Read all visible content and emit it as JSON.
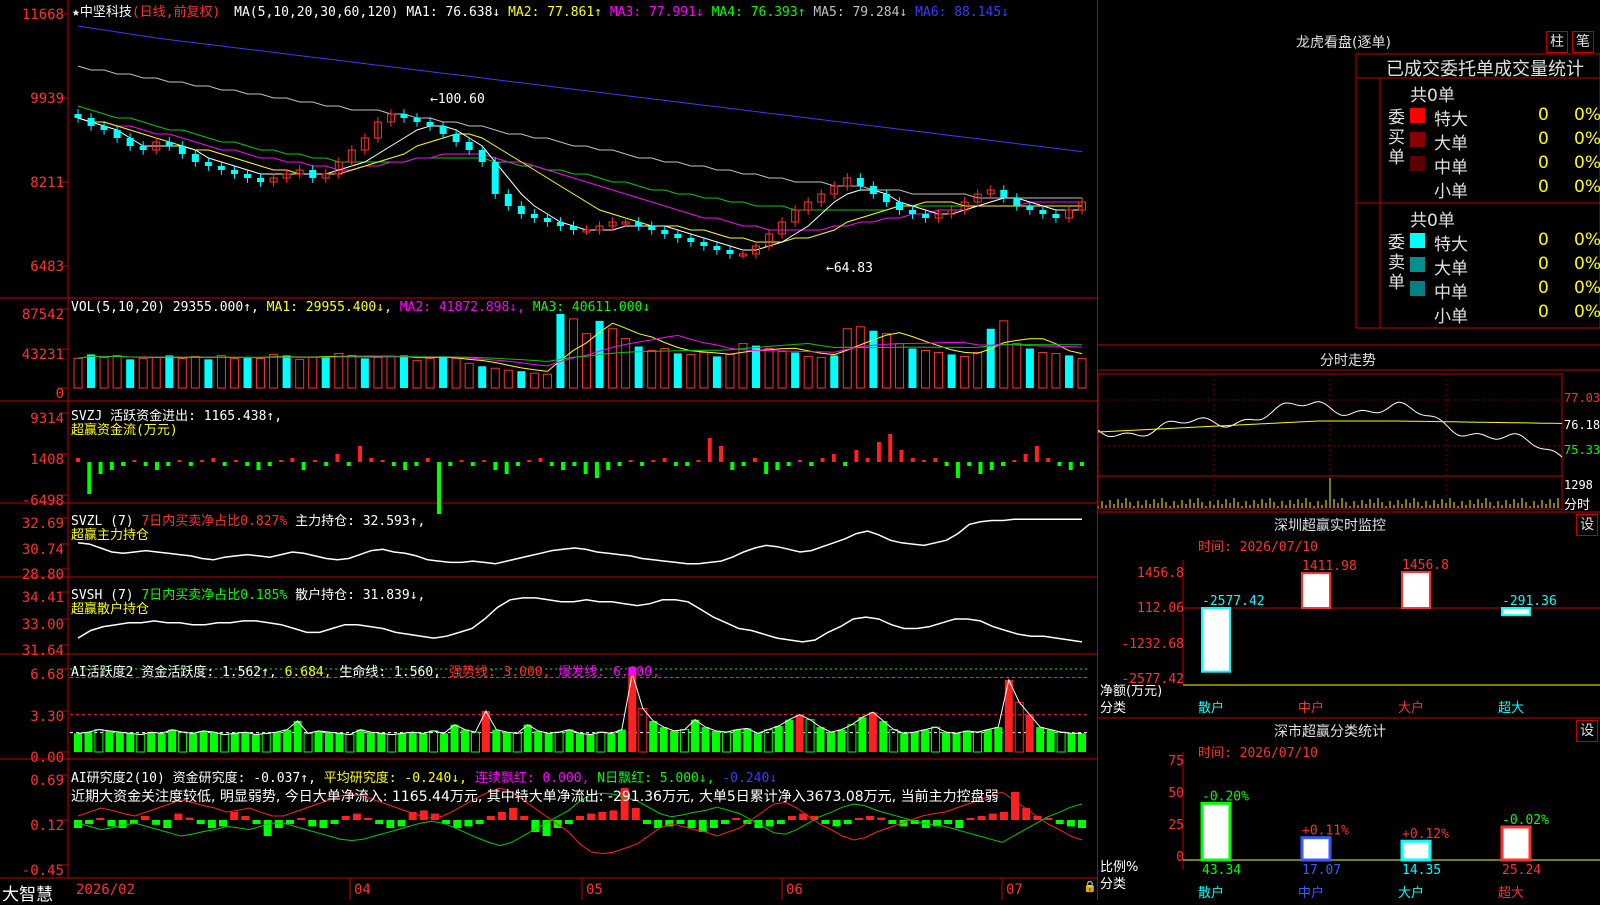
{
  "main": {
    "title": "★中坚科技",
    "period": "(日线,前复权)",
    "ma_prefix": "MA(5,10,20,30,60,120)",
    "ma_items": [
      {
        "label": "MA1: 76.638↓",
        "color": "#ffffff"
      },
      {
        "label": "MA2: 77.861↑",
        "color": "#ffff00"
      },
      {
        "label": "MA3: 77.991↓",
        "color": "#ff00ff"
      },
      {
        "label": "MA4: 76.393↑",
        "color": "#00ff00"
      },
      {
        "label": "MA5: 79.284↓",
        "color": "#c0c0c0"
      },
      {
        "label": "MA6: 88.145↓",
        "color": "#3a3aff"
      }
    ],
    "y_ticks": [
      "11668",
      "9939",
      "8211",
      "6483"
    ],
    "high_label": "100.60",
    "low_label": "64.83",
    "price_series": {
      "closes": [
        99,
        97,
        96,
        94,
        92,
        91,
        93,
        92,
        90,
        88,
        87,
        86,
        85,
        84,
        83,
        84,
        85,
        86,
        84,
        85,
        88,
        91,
        94,
        98,
        100,
        99,
        98,
        97,
        95,
        93,
        91,
        88,
        80,
        77,
        75,
        74,
        73,
        72,
        71,
        71,
        72,
        73,
        73,
        72,
        71,
        70,
        69,
        68,
        67,
        66,
        65,
        65,
        67,
        70,
        73,
        76,
        78,
        80,
        82,
        84,
        82,
        80,
        78,
        76,
        75,
        74,
        75,
        76,
        78,
        80,
        81,
        79,
        77,
        76,
        75,
        74,
        76,
        78
      ],
      "ma5": [
        99,
        98,
        97,
        96,
        94,
        92,
        92,
        92,
        92,
        91,
        89,
        88,
        87,
        86,
        85,
        85,
        85,
        85,
        85,
        85,
        86,
        87,
        88,
        90,
        92,
        94,
        96,
        97,
        97,
        96,
        94,
        92,
        88,
        84,
        80,
        77,
        75,
        73,
        72,
        71,
        71,
        71,
        72,
        72,
        72,
        72,
        71,
        70,
        69,
        68,
        67,
        66,
        66,
        67,
        68,
        70,
        72,
        75,
        78,
        80,
        81,
        81,
        80,
        78,
        77,
        76,
        75,
        75,
        76,
        77,
        78,
        79,
        79,
        78,
        77,
        76,
        76,
        76
      ],
      "ma10": [
        99,
        98,
        98,
        97,
        96,
        95,
        94,
        93,
        92,
        91,
        91,
        90,
        89,
        88,
        87,
        86,
        86,
        85,
        85,
        85,
        85,
        86,
        87,
        88,
        89,
        90,
        92,
        93,
        94,
        95,
        95,
        94,
        92,
        90,
        88,
        86,
        84,
        82,
        80,
        78,
        76,
        75,
        74,
        73,
        72,
        72,
        72,
        71,
        71,
        70,
        69,
        69,
        68,
        68,
        68,
        69,
        69,
        70,
        71,
        73,
        74,
        75,
        76,
        77,
        77,
        78,
        78,
        78,
        77,
        77,
        77,
        77,
        77,
        77,
        77,
        77,
        77,
        77
      ],
      "ma20": [
        99,
        98,
        98,
        97,
        97,
        96,
        95,
        95,
        94,
        93,
        92,
        91,
        91,
        90,
        89,
        89,
        88,
        88,
        87,
        87,
        86,
        86,
        87,
        87,
        88,
        88,
        89,
        89,
        90,
        90,
        90,
        90,
        89,
        88,
        88,
        87,
        86,
        85,
        84,
        83,
        82,
        81,
        80,
        79,
        78,
        77,
        76,
        75,
        74,
        74,
        73,
        72,
        72,
        71,
        71,
        71,
        71,
        71,
        72,
        72,
        73,
        73,
        74,
        74,
        75,
        75,
        76,
        76,
        76,
        77,
        77,
        77,
        77,
        78,
        78,
        78,
        78,
        78
      ],
      "ma30": [
        102,
        101,
        100,
        99,
        99,
        98,
        97,
        96,
        96,
        95,
        94,
        93,
        93,
        92,
        91,
        91,
        90,
        90,
        89,
        89,
        88,
        88,
        88,
        88,
        88,
        88,
        89,
        89,
        89,
        89,
        89,
        89,
        88,
        88,
        87,
        87,
        86,
        86,
        85,
        85,
        84,
        83,
        83,
        82,
        81,
        81,
        80,
        80,
        79,
        79,
        78,
        78,
        77,
        77,
        77,
        76,
        76,
        76,
        76,
        76,
        76,
        76,
        76,
        77,
        77,
        77,
        77,
        77,
        77,
        77,
        77,
        77,
        77,
        77,
        77,
        77,
        77,
        77
      ],
      "ma60": [
        112,
        111,
        111,
        110,
        110,
        109,
        109,
        108,
        108,
        107,
        107,
        106,
        106,
        105,
        105,
        104,
        104,
        103,
        103,
        102,
        102,
        101,
        101,
        101,
        100,
        100,
        99,
        99,
        98,
        98,
        97,
        97,
        96,
        95,
        95,
        94,
        94,
        93,
        92,
        92,
        91,
        91,
        90,
        89,
        89,
        88,
        88,
        87,
        87,
        86,
        86,
        85,
        85,
        84,
        84,
        83,
        83,
        83,
        82,
        82,
        82,
        81,
        81,
        81,
        80,
        80,
        80,
        80,
        80,
        79,
        79,
        79,
        79,
        79,
        79,
        79,
        79,
        79
      ],
      "ma120": [
        122,
        121.5,
        121,
        120.5,
        120,
        119.5,
        119,
        118.6,
        118.2,
        117.8,
        117.4,
        117,
        116.6,
        116.2,
        115.8,
        115.4,
        115,
        114.6,
        114.2,
        113.8,
        113.4,
        113,
        112.6,
        112.2,
        111.8,
        111.4,
        111,
        110.6,
        110.2,
        109.8,
        109.4,
        109,
        108.6,
        108.2,
        107.8,
        107.4,
        107,
        106.6,
        106.2,
        105.8,
        105.4,
        105,
        104.6,
        104.2,
        103.8,
        103.4,
        103,
        102.6,
        102.2,
        101.8,
        101.4,
        101,
        100.6,
        100.2,
        99.8,
        99.4,
        99,
        98.6,
        98.2,
        97.8,
        97.4,
        97,
        96.6,
        96.2,
        95.8,
        95.4,
        95,
        94.6,
        94.2,
        93.8,
        93.4,
        93,
        92.6,
        92.2,
        91.8,
        91.4,
        91,
        90.6
      ]
    }
  },
  "vol": {
    "header": "VOL(5,10,20)",
    "value": "29355.000↑,",
    "ma_items": [
      {
        "label": "MA1: 29955.400↓,",
        "color": "#ffff00"
      },
      {
        "label": "MA2: 41872.898↓,",
        "color": "#ff00ff"
      },
      {
        "label": "MA3: 40611.000↓",
        "color": "#00ff00"
      }
    ],
    "y_ticks": [
      "87542",
      "43231",
      "0"
    ],
    "values": [
      30,
      34,
      31,
      33,
      29,
      30,
      31,
      33,
      30,
      32,
      29,
      33,
      30,
      31,
      30,
      34,
      33,
      29,
      31,
      32,
      35,
      33,
      30,
      31,
      32,
      33,
      28,
      30,
      32,
      30,
      25,
      22,
      20,
      18,
      17,
      15,
      14,
      75,
      70,
      55,
      68,
      60,
      50,
      42,
      38,
      40,
      35,
      34,
      36,
      32,
      34,
      45,
      43,
      40,
      37,
      36,
      32,
      31,
      33,
      60,
      62,
      58,
      55,
      45,
      40,
      38,
      36,
      34,
      32,
      36,
      60,
      68,
      45,
      40,
      36,
      35,
      33,
      30
    ]
  },
  "svzj": {
    "header": "SVZJ  活跃资金进出: 1165.438↑,",
    "sub": "超赢资金流(万元)",
    "y_ticks": [
      "9314",
      "1408",
      "-6498"
    ],
    "values": [
      1,
      -8,
      -3,
      -2,
      -1,
      0,
      -1,
      -2,
      -1,
      0,
      -1,
      0,
      1,
      -1,
      0,
      -1,
      -2,
      -1,
      0,
      1,
      -2,
      0,
      -1,
      2,
      -1,
      4,
      1,
      0,
      -1,
      -2,
      -1,
      1,
      -13,
      -1,
      0,
      -1,
      0,
      -2,
      -3,
      -1,
      0,
      1,
      -1,
      -2,
      -1,
      -3,
      -4,
      -2,
      -1,
      0,
      -1,
      0,
      1,
      -1,
      -1,
      0,
      6,
      4,
      -2,
      -1,
      1,
      -3,
      -2,
      -1,
      0,
      -1,
      1,
      2,
      -1,
      3,
      1,
      5,
      7,
      3,
      1,
      0,
      1,
      -1,
      -4,
      -1,
      -3,
      -2,
      -1,
      0,
      2,
      4,
      1,
      -1,
      -2,
      -1
    ]
  },
  "svzl": {
    "header_a": "SVZL (7)",
    "header_b": "7日内买卖净占比0.827%",
    "header_c": "主力持仓: 32.593↑,",
    "sub": "超赢主力持仓",
    "y_ticks": [
      "32.69",
      "30.74",
      "28.80"
    ],
    "values": [
      30.8,
      30.7,
      30.4,
      30.1,
      30.0,
      30.1,
      30.2,
      30.1,
      30.0,
      29.9,
      29.8,
      29.6,
      29.5,
      29.7,
      29.8,
      29.9,
      29.8,
      29.7,
      29.9,
      30.1,
      30.0,
      29.8,
      29.6,
      29.5,
      29.6,
      29.9,
      30.2,
      30.3,
      30.1,
      30.0,
      29.8,
      29.5,
      29.4,
      29.3,
      29.3,
      29.4,
      29.3,
      29.2,
      29.4,
      29.6,
      29.8,
      30.0,
      30.2,
      30.3,
      30.4,
      30.3,
      30.1,
      30.0,
      29.9,
      29.8,
      29.6,
      29.5,
      29.4,
      29.3,
      29.2,
      29.2,
      29.3,
      29.4,
      29.7,
      30.1,
      30.4,
      30.6,
      30.5,
      30.3,
      30.1,
      30.2,
      30.5,
      30.8,
      31.1,
      31.5,
      31.7,
      31.4,
      31.0,
      30.8,
      30.7,
      30.6,
      30.8,
      31.0,
      31.5,
      32.2,
      32.4,
      32.5,
      32.5,
      32.6,
      32.6,
      32.6,
      32.6,
      32.6,
      32.6,
      32.6
    ]
  },
  "svsh": {
    "header_a": "SVSH (7)",
    "header_b": "7日内买卖净占比0.185%",
    "header_c": "散户持仓: 31.839↓,",
    "sub": "超赢散户持仓",
    "y_ticks": [
      "34.41",
      "33.00",
      "31.64"
    ],
    "values": [
      32.0,
      32.4,
      32.6,
      32.7,
      32.8,
      32.8,
      32.9,
      32.8,
      32.8,
      32.7,
      32.7,
      32.8,
      32.8,
      32.9,
      32.9,
      32.8,
      32.7,
      32.5,
      32.3,
      32.3,
      32.5,
      32.7,
      32.7,
      32.6,
      32.5,
      32.3,
      32.2,
      32.1,
      32.0,
      32.1,
      32.3,
      32.5,
      33.0,
      33.6,
      34.0,
      34.1,
      34.1,
      34.0,
      33.9,
      33.9,
      34.0,
      33.9,
      33.9,
      33.8,
      33.7,
      33.8,
      34.0,
      34.0,
      33.9,
      33.5,
      33.1,
      32.8,
      32.5,
      32.4,
      32.2,
      32.0,
      31.9,
      31.8,
      31.9,
      32.3,
      32.6,
      33.0,
      33.1,
      33.0,
      32.7,
      32.5,
      32.5,
      32.6,
      32.8,
      33.0,
      33.0,
      32.9,
      32.6,
      32.4,
      32.2,
      32.1,
      32.1,
      32.0,
      31.9,
      31.8
    ]
  },
  "ai1": {
    "header": "AI活跃度2",
    "items": [
      {
        "label": "资金活跃度: 1.562↑,",
        "color": "#ffffff"
      },
      {
        "label": "6.684,",
        "color": "#ffff00"
      },
      {
        "label": "生命线: 1.560,",
        "color": "#ffffff"
      },
      {
        "label": "强势线: 3.000,",
        "color": "#ff3030"
      },
      {
        "label": "爆发线: 6.000,",
        "color": "#ff00ff"
      }
    ],
    "y_ticks": [
      "6.68",
      "3.30",
      "0.00"
    ],
    "values": [
      1.5,
      1.6,
      1.8,
      1.7,
      1.6,
      1.5,
      1.4,
      1.6,
      1.5,
      1.8,
      1.6,
      1.5,
      1.7,
      1.6,
      1.4,
      1.5,
      1.6,
      1.4,
      1.5,
      1.6,
      1.8,
      2.5,
      1.5,
      1.7,
      1.6,
      1.5,
      1.4,
      1.8,
      1.6,
      1.5,
      1.4,
      1.5,
      1.6,
      1.5,
      1.7,
      1.5,
      2.2,
      1.8,
      1.6,
      3.3,
      1.8,
      1.6,
      1.5,
      2.2,
      1.7,
      1.5,
      1.6,
      1.8,
      1.5,
      1.4,
      1.6,
      1.5,
      1.8,
      6.3,
      3.5,
      2.5,
      2.0,
      1.7,
      1.8,
      2.6,
      2.0,
      1.7,
      1.6,
      1.8,
      1.9,
      1.5,
      1.8,
      2.1,
      2.6,
      3.0,
      2.6,
      2.0,
      1.6,
      1.8,
      2.2,
      2.8,
      3.2,
      2.5,
      1.8,
      1.5,
      1.6,
      1.8,
      2.0,
      1.6,
      1.5,
      1.7,
      1.6,
      1.8,
      2.0,
      5.8,
      4.0,
      3.0,
      2.0,
      1.8,
      1.6,
      1.5,
      1.5
    ]
  },
  "ai2": {
    "header": "AI研究度2(10)",
    "items": [
      {
        "label": "资金研究度: -0.037↑,",
        "color": "#ffffff"
      },
      {
        "label": "平均研究度: -0.240↓,",
        "color": "#ffff00"
      },
      {
        "label": "连续飘红: 0.000,",
        "color": "#ff00ff"
      },
      {
        "label": "N日飘红: 5.000↓,",
        "color": "#00ff00"
      },
      {
        "label": "-0.240↓",
        "color": "#3a3aff"
      }
    ],
    "note": "近期大资金关注度较低, 明显弱势, 今日大单净流入: 1165.44万元, 其中特大单净流出: -291.36万元, 大单5日累计净入3673.08万元, 当前主力控盘弱",
    "y_ticks": [
      "0.69",
      "0.12",
      "-0.45"
    ],
    "values": [
      -0.1,
      -0.05,
      0.02,
      -0.08,
      -0.1,
      -0.05,
      0.05,
      -0.06,
      -0.1,
      0.08,
      0.03,
      -0.05,
      -0.1,
      -0.08,
      0.1,
      0.05,
      -0.05,
      -0.2,
      -0.1,
      -0.05,
      0.02,
      -0.08,
      -0.1,
      -0.05,
      0.05,
      0.08,
      0.02,
      -0.05,
      -0.1,
      -0.08,
      0.1,
      0.12,
      0.08,
      -0.05,
      -0.1,
      -0.08,
      -0.05,
      0.05,
      0.1,
      0.15,
      0.05,
      -0.15,
      -0.2,
      -0.1,
      -0.05,
      0.05,
      0.08,
      0.1,
      0.12,
      0.4,
      0.15,
      -0.05,
      -0.1,
      -0.08,
      -0.05,
      -0.1,
      -0.15,
      -0.1,
      -0.05,
      0.02,
      -0.05,
      -0.1,
      -0.08,
      -0.05,
      0.05,
      0.08,
      0.05,
      -0.05,
      -0.08,
      -0.05,
      0.02,
      0.05,
      0.03,
      -0.05,
      -0.08,
      -0.05,
      -0.1,
      -0.08,
      -0.05,
      -0.1,
      0.02,
      0.05,
      0.08,
      0.1,
      0.35,
      0.15,
      0.05,
      0.02,
      -0.05,
      -0.08,
      -0.1
    ],
    "line": [
      0.05,
      0.1,
      0.15,
      0.12,
      0.08,
      0.05,
      0.1,
      0.15,
      0.2,
      0.25,
      0.22,
      0.18,
      0.15,
      0.1,
      0.12,
      0.15,
      0.1,
      0.05,
      0.05,
      0.1,
      0.15,
      0.2,
      0.25,
      0.3,
      0.32,
      0.3,
      0.25,
      0.2,
      0.15,
      0.1,
      0.05,
      0.02,
      0.05,
      0.12,
      0.2,
      0.28,
      0.35,
      0.4,
      0.35,
      0.25,
      0.15,
      0.05,
      -0.05,
      -0.15,
      -0.3,
      -0.4,
      -0.42,
      -0.4,
      -0.35,
      -0.3,
      -0.2,
      -0.1,
      -0.05,
      -0.08,
      -0.12,
      -0.15,
      -0.2,
      -0.15,
      -0.1,
      0.0,
      0.1,
      0.2,
      0.22,
      0.15,
      0.05,
      -0.05,
      -0.12,
      -0.2,
      -0.25,
      -0.22,
      -0.15,
      -0.1,
      -0.05,
      0.0,
      0.05,
      0.08,
      0.1,
      0.15,
      0.2,
      0.25,
      0.3,
      0.35,
      0.25,
      0.15,
      0.05,
      -0.05,
      -0.12,
      -0.2,
      -0.25
    ]
  },
  "dates": {
    "brand": "大智慧",
    "labels": [
      "2026/02",
      "04",
      "05",
      "06",
      "07"
    ]
  },
  "lhb": {
    "title": "龙虎看盘(逐单)",
    "btn_zhu": "柱",
    "btn_bi": "笔",
    "header": "已成交委托单成交量统计",
    "buy_side": "委买单",
    "sell_side": "委卖单",
    "buy_total": "共0单",
    "sell_total": "共0单",
    "rows": [
      {
        "label": "特大",
        "count": "0",
        "pct": "0%"
      },
      {
        "label": "大单",
        "count": "0",
        "pct": "0%"
      },
      {
        "label": "中单",
        "count": "0",
        "pct": "0%"
      },
      {
        "label": "小单",
        "count": "0",
        "pct": "0%"
      }
    ]
  },
  "intraday": {
    "title": "分时走势",
    "price_ticks": [
      "77.03",
      "76.18",
      "75.33"
    ],
    "vol_tick": "1298",
    "vol_unit": "分时"
  },
  "sz_monitor": {
    "title": "深圳超赢实时监控",
    "settings": "设",
    "time": "时间: 2026/07/10",
    "y_ticks": [
      "1456.8",
      "112.06",
      "-1232.68",
      "-2577.42"
    ],
    "y_unit": "净额(万元)",
    "x_unit": "分类",
    "chart_data": {
      "type": "bar",
      "categories": [
        "散户",
        "中户",
        "大户",
        "超大"
      ],
      "values": [
        -2577.42,
        1411.98,
        1456.8,
        -291.36
      ]
    }
  },
  "sz_class": {
    "title": "深市超赢分类统计",
    "settings": "设",
    "time": "时间: 2026/07/10",
    "y_ticks": [
      "75",
      "50",
      "25",
      "0"
    ],
    "y_unit": "比例%",
    "x_unit": "分类",
    "chart_data": {
      "type": "bar",
      "categories": [
        "散户",
        "中户",
        "大户",
        "超大"
      ],
      "values": [
        43.34,
        17.07,
        14.35,
        25.24
      ],
      "changes": [
        "-0.20%",
        "+0.11%",
        "+0.12%",
        "-0.02%"
      ]
    }
  }
}
